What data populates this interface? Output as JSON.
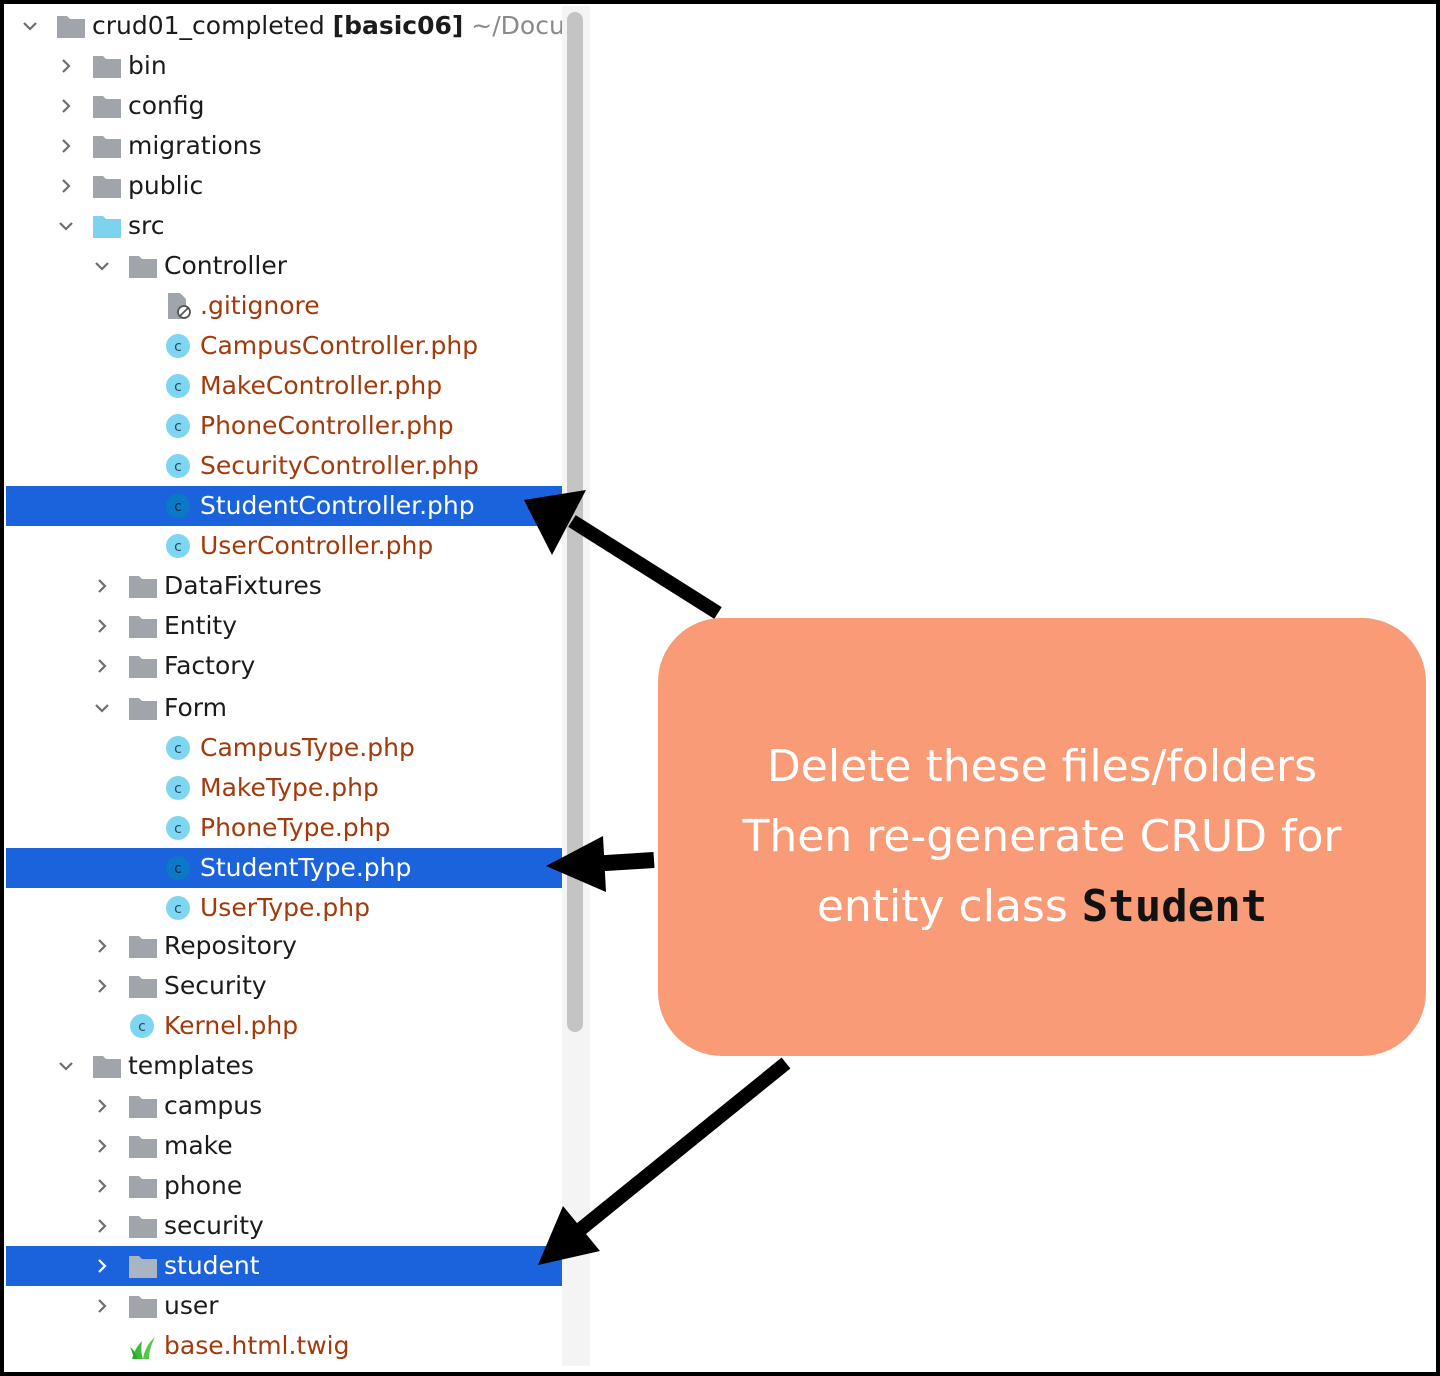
{
  "project_tree": {
    "root": {
      "name": "crud01_completed",
      "module": "[basic06]",
      "path": "~/Docu"
    },
    "items": [
      {
        "label": "bin"
      },
      {
        "label": "config"
      },
      {
        "label": "migrations"
      },
      {
        "label": "public"
      },
      {
        "label": "src"
      },
      {
        "label": "Controller"
      },
      {
        "label": ".gitignore"
      },
      {
        "label": "CampusController.php"
      },
      {
        "label": "MakeController.php"
      },
      {
        "label": "PhoneController.php"
      },
      {
        "label": "SecurityController.php"
      },
      {
        "label": "StudentController.php"
      },
      {
        "label": "UserController.php"
      },
      {
        "label": "DataFixtures"
      },
      {
        "label": "Entity"
      },
      {
        "label": "Factory"
      },
      {
        "label": "Form"
      },
      {
        "label": "CampusType.php"
      },
      {
        "label": "MakeType.php"
      },
      {
        "label": "PhoneType.php"
      },
      {
        "label": "StudentType.php"
      },
      {
        "label": "UserType.php"
      },
      {
        "label": "Repository"
      },
      {
        "label": "Security"
      },
      {
        "label": "Kernel.php"
      },
      {
        "label": "templates"
      },
      {
        "label": "campus"
      },
      {
        "label": "make"
      },
      {
        "label": "phone"
      },
      {
        "label": "security"
      },
      {
        "label": "student"
      },
      {
        "label": "user"
      },
      {
        "label": "base.html.twig"
      }
    ]
  },
  "callout": {
    "line1": "Delete these files/folders",
    "line2": "Then re-generate CRUD for",
    "line3_prefix": "entity class",
    "line3_code": "Student"
  },
  "colors": {
    "selection": "#1a63dc",
    "callout": "#f89b76",
    "file_text": "#a33a0b",
    "class_icon": "#7ed6f2"
  }
}
